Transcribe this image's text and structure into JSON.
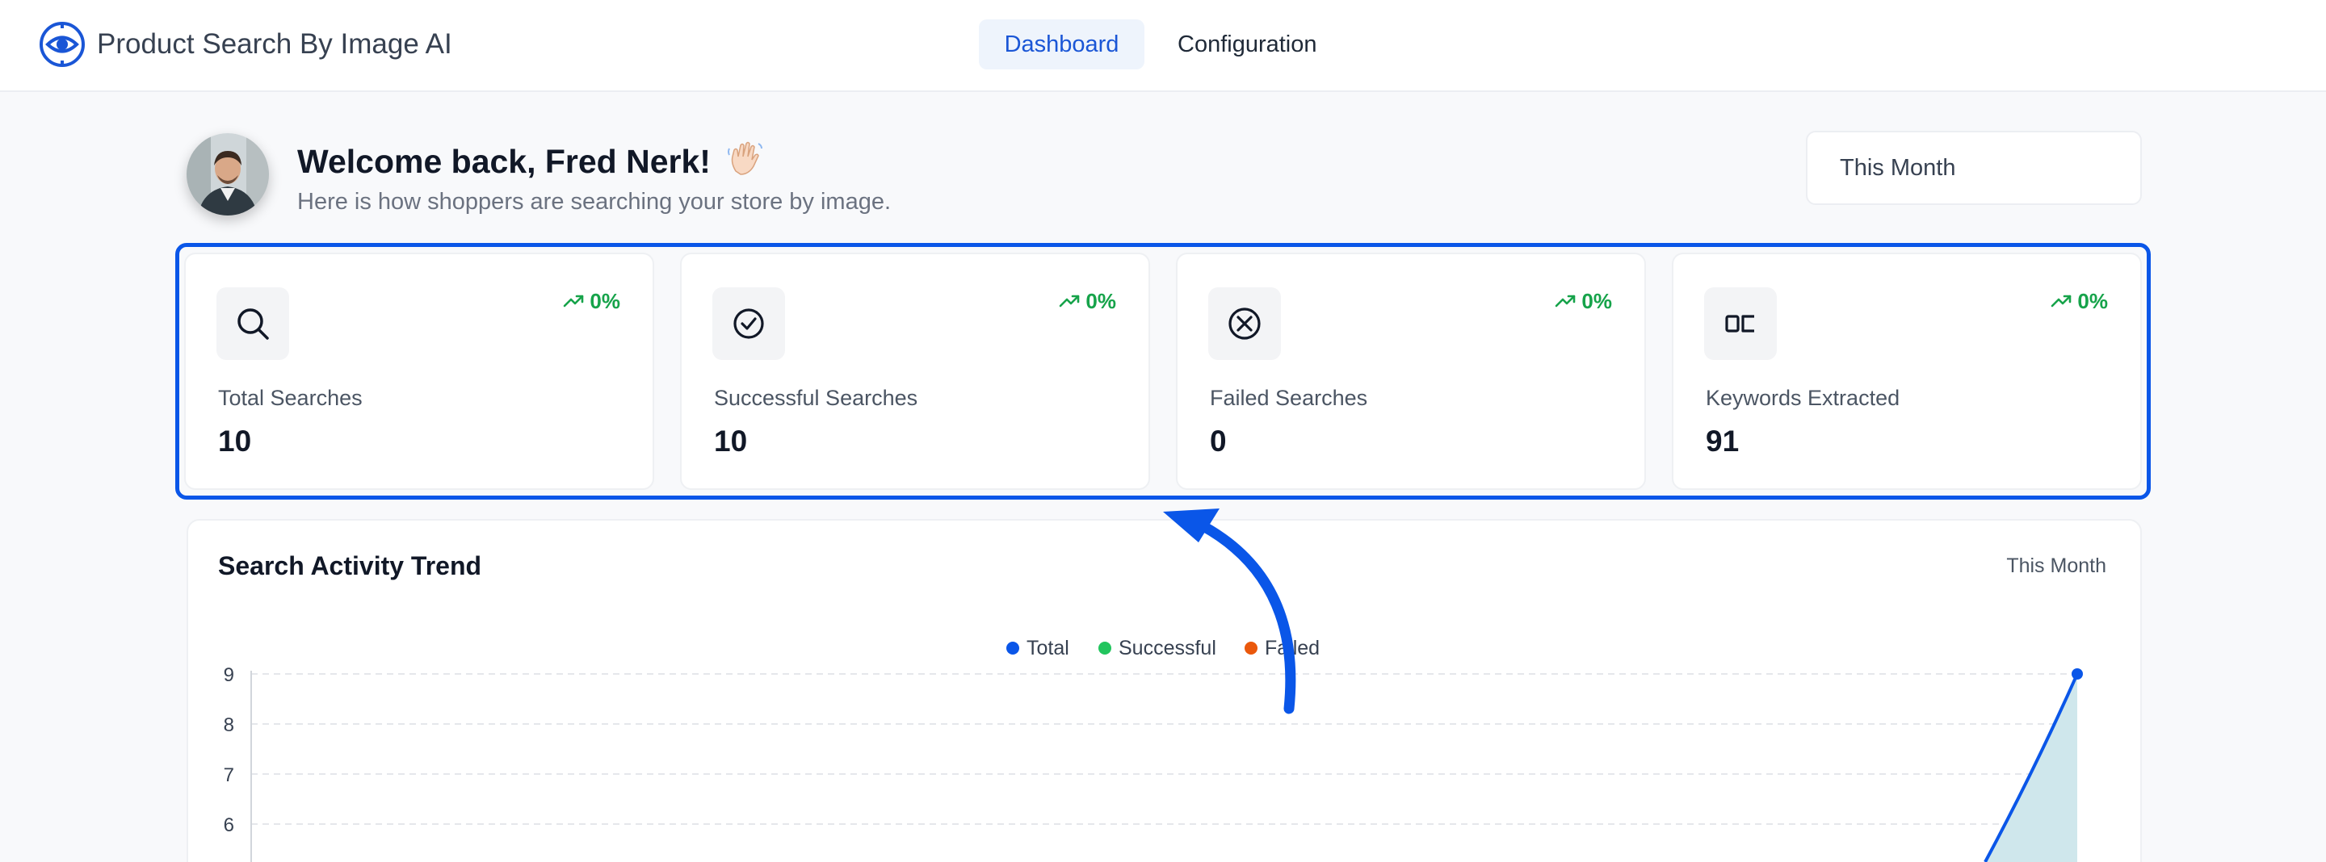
{
  "app": {
    "name": "Product Search By Image AI",
    "logo_icon": "eye-search-icon",
    "accent_color": "#1a56d6"
  },
  "nav": {
    "tabs": [
      {
        "label": "Dashboard",
        "active": true
      },
      {
        "label": "Configuration",
        "active": false
      }
    ]
  },
  "welcome": {
    "title": "Welcome back, Fred Nerk!",
    "emoji_icon": "waving-hand-icon",
    "subtitle": "Here is how shoppers are searching your store by image."
  },
  "period_selector": {
    "value": "This Month"
  },
  "stats": [
    {
      "icon": "search-icon",
      "label": "Total Searches",
      "value": "10",
      "trend": "0%",
      "trend_icon": "trending-up-icon"
    },
    {
      "icon": "check-circle-icon",
      "label": "Successful Searches",
      "value": "10",
      "trend": "0%",
      "trend_icon": "trending-up-icon"
    },
    {
      "icon": "x-circle-icon",
      "label": "Failed Searches",
      "value": "0",
      "trend": "0%",
      "trend_icon": "trending-up-icon"
    },
    {
      "icon": "ocr-icon",
      "label": "Keywords Extracted",
      "value": "91",
      "trend": "0%",
      "trend_icon": "trending-up-icon"
    }
  ],
  "trend": {
    "title": "Search Activity Trend",
    "period_label": "This Month"
  },
  "chart_data": {
    "type": "area",
    "title": "Search Activity Trend",
    "legend_position": "top-center",
    "series": [
      {
        "name": "Total",
        "color": "#0a56e8"
      },
      {
        "name": "Successful",
        "color": "#22c55e"
      },
      {
        "name": "Failed",
        "color": "#ea580c"
      }
    ],
    "yticks": [
      9,
      8,
      7,
      6
    ],
    "y_visible_range": [
      5,
      9
    ],
    "grid": true,
    "visible_last_point": {
      "series": "Total",
      "y": 9
    }
  }
}
